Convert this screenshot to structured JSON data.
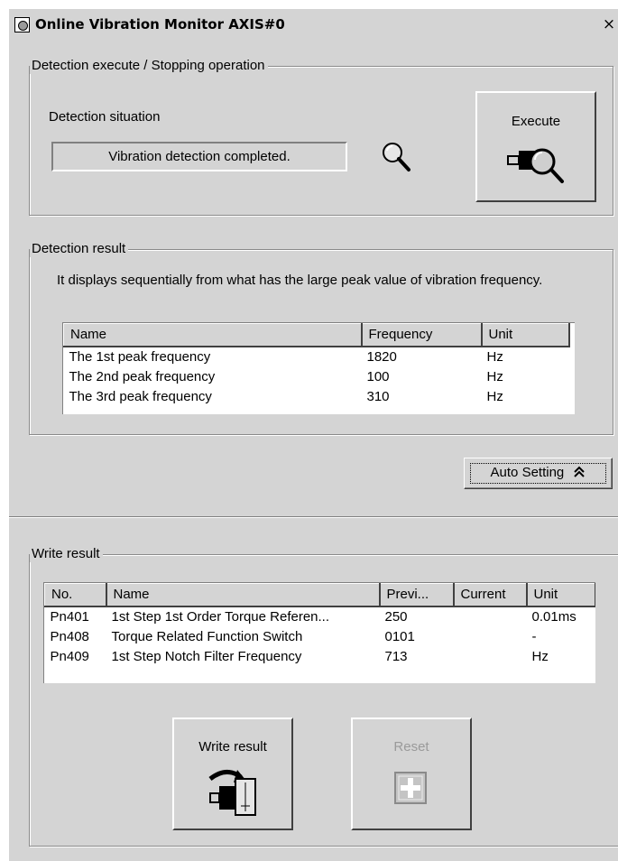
{
  "window": {
    "title": "Online Vibration Monitor AXIS#0",
    "close": "×"
  },
  "detection": {
    "group_label": "Detection execute / Stopping operation",
    "situation_label": "Detection situation",
    "situation_value": "Vibration detection completed.",
    "execute_label": "Execute"
  },
  "result": {
    "group_label": "Detection result",
    "description": "It displays sequentially from what has the large peak value of vibration frequency.",
    "columns": [
      "Name",
      "Frequency",
      "Unit"
    ],
    "rows": [
      [
        "The 1st peak frequency",
        "1820",
        "Hz"
      ],
      [
        "The 2nd peak frequency",
        "100",
        "Hz"
      ],
      [
        "The 3rd peak frequency",
        "310",
        "Hz"
      ]
    ]
  },
  "auto_setting": {
    "label": "Auto Setting",
    "icon": "double-chevron-up-icon"
  },
  "write": {
    "group_label": "Write result",
    "columns": [
      "No.",
      "Name",
      "Previ...",
      "Current",
      "Unit"
    ],
    "rows": [
      [
        "Pn401",
        "1st Step 1st Order Torque Referen...",
        "250",
        "",
        "0.01ms"
      ],
      [
        "Pn408",
        "Torque Related Function Switch",
        "0101",
        "",
        "-"
      ],
      [
        "Pn409",
        "1st Step Notch Filter Frequency",
        "713",
        "",
        "Hz"
      ]
    ],
    "write_button_label": "Write result",
    "reset_button_label": "Reset"
  },
  "colors": {
    "face": "#d4d4d4",
    "shadow": "#808080",
    "disabled_text": "#9a9a9a"
  }
}
